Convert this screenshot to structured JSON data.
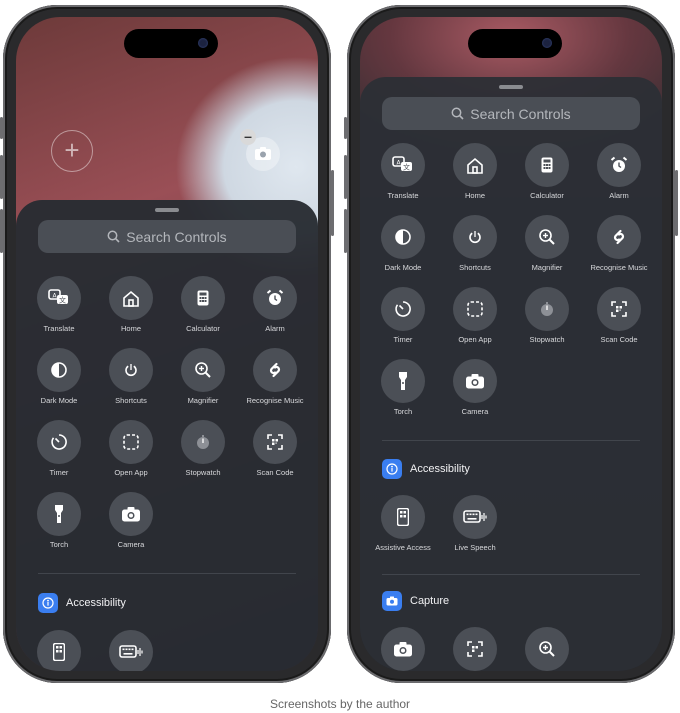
{
  "search": {
    "placeholder": "Search Controls"
  },
  "controls": [
    {
      "label": "Translate",
      "icon": "translate-icon"
    },
    {
      "label": "Home",
      "icon": "home-icon"
    },
    {
      "label": "Calculator",
      "icon": "calculator-icon"
    },
    {
      "label": "Alarm",
      "icon": "alarm-icon"
    },
    {
      "label": "Dark Mode",
      "icon": "dark-mode-icon"
    },
    {
      "label": "Shortcuts",
      "icon": "shortcuts-icon"
    },
    {
      "label": "Magnifier",
      "icon": "magnifier-icon"
    },
    {
      "label": "Recognise Music",
      "icon": "shazam-icon"
    },
    {
      "label": "Timer",
      "icon": "timer-icon"
    },
    {
      "label": "Open App",
      "icon": "open-app-icon"
    },
    {
      "label": "Stopwatch",
      "icon": "stopwatch-icon"
    },
    {
      "label": "Scan Code",
      "icon": "scan-code-icon"
    },
    {
      "label": "Torch",
      "icon": "torch-icon"
    },
    {
      "label": "Camera",
      "icon": "camera-icon"
    }
  ],
  "accessibility": {
    "title": "Accessibility",
    "items": [
      {
        "label": "Assistive Access",
        "icon": "assistive-access-icon"
      },
      {
        "label": "Live Speech",
        "icon": "live-speech-icon"
      }
    ]
  },
  "capture": {
    "title": "Capture"
  },
  "caption": "Screenshots by the author",
  "colors": {
    "accent": "#3a7ef0",
    "sheet": "#2c3036"
  }
}
